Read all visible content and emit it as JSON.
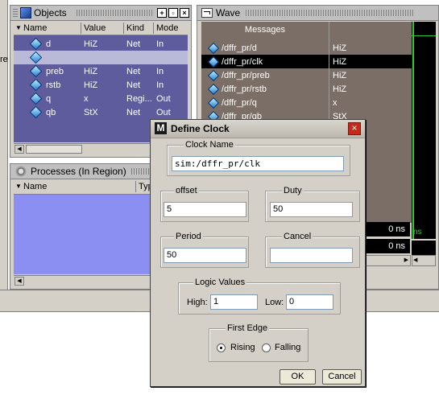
{
  "left_strip": {
    "fragment": "re"
  },
  "objects": {
    "title": "Objects",
    "columns": [
      "Name",
      "Value",
      "Kind",
      "Mode"
    ],
    "rows": [
      {
        "name": "d",
        "value": "HiZ",
        "kind": "Net",
        "mode": "In"
      },
      {
        "name": "",
        "value": "",
        "kind": "",
        "mode": ""
      },
      {
        "name": "preb",
        "value": "HiZ",
        "kind": "Net",
        "mode": "In"
      },
      {
        "name": "rstb",
        "value": "HiZ",
        "kind": "Net",
        "mode": "In"
      },
      {
        "name": "q",
        "value": "x",
        "kind": "Regi...",
        "mode": "Out"
      },
      {
        "name": "qb",
        "value": "StX",
        "kind": "Net",
        "mode": "Out"
      }
    ]
  },
  "processes": {
    "title": "Processes (In Region)",
    "columns": [
      "Name",
      "Typ"
    ]
  },
  "wave": {
    "title": "Wave",
    "messages_header": "Messages",
    "rows": [
      {
        "signal": "/dffr_pr/d",
        "value": "HiZ"
      },
      {
        "signal": "/dffr_pr/clk",
        "value": "HiZ"
      },
      {
        "signal": "/dffr_pr/preb",
        "value": "HiZ"
      },
      {
        "signal": "/dffr_pr/rstb",
        "value": "HiZ"
      },
      {
        "signal": "/dffr_pr/q",
        "value": "x"
      },
      {
        "signal": "/dffr_pr/qb",
        "value": "StX"
      }
    ],
    "cursor_time_1": "0 ns",
    "cursor_time_2": "0 ns",
    "plot_label": "ns"
  },
  "dialog": {
    "title": "Define Clock",
    "clock_name_label": "Clock Name",
    "clock_name_value": "sim:/dffr_pr/clk",
    "offset_label": "offset",
    "offset_value": "5",
    "duty_label": "Duty",
    "duty_value": "50",
    "period_label": "Period",
    "period_value": "50",
    "cancel_label": "Cancel",
    "cancel_value": "",
    "logic_values_label": "Logic Values",
    "high_label": "High:",
    "high_value": "1",
    "low_label": "Low:",
    "low_value": "0",
    "first_edge_label": "First Edge",
    "rising_label": "Rising",
    "falling_label": "Falling",
    "first_edge_selected": "Rising",
    "ok_label": "OK",
    "cancel_button_label": "Cancel"
  }
}
